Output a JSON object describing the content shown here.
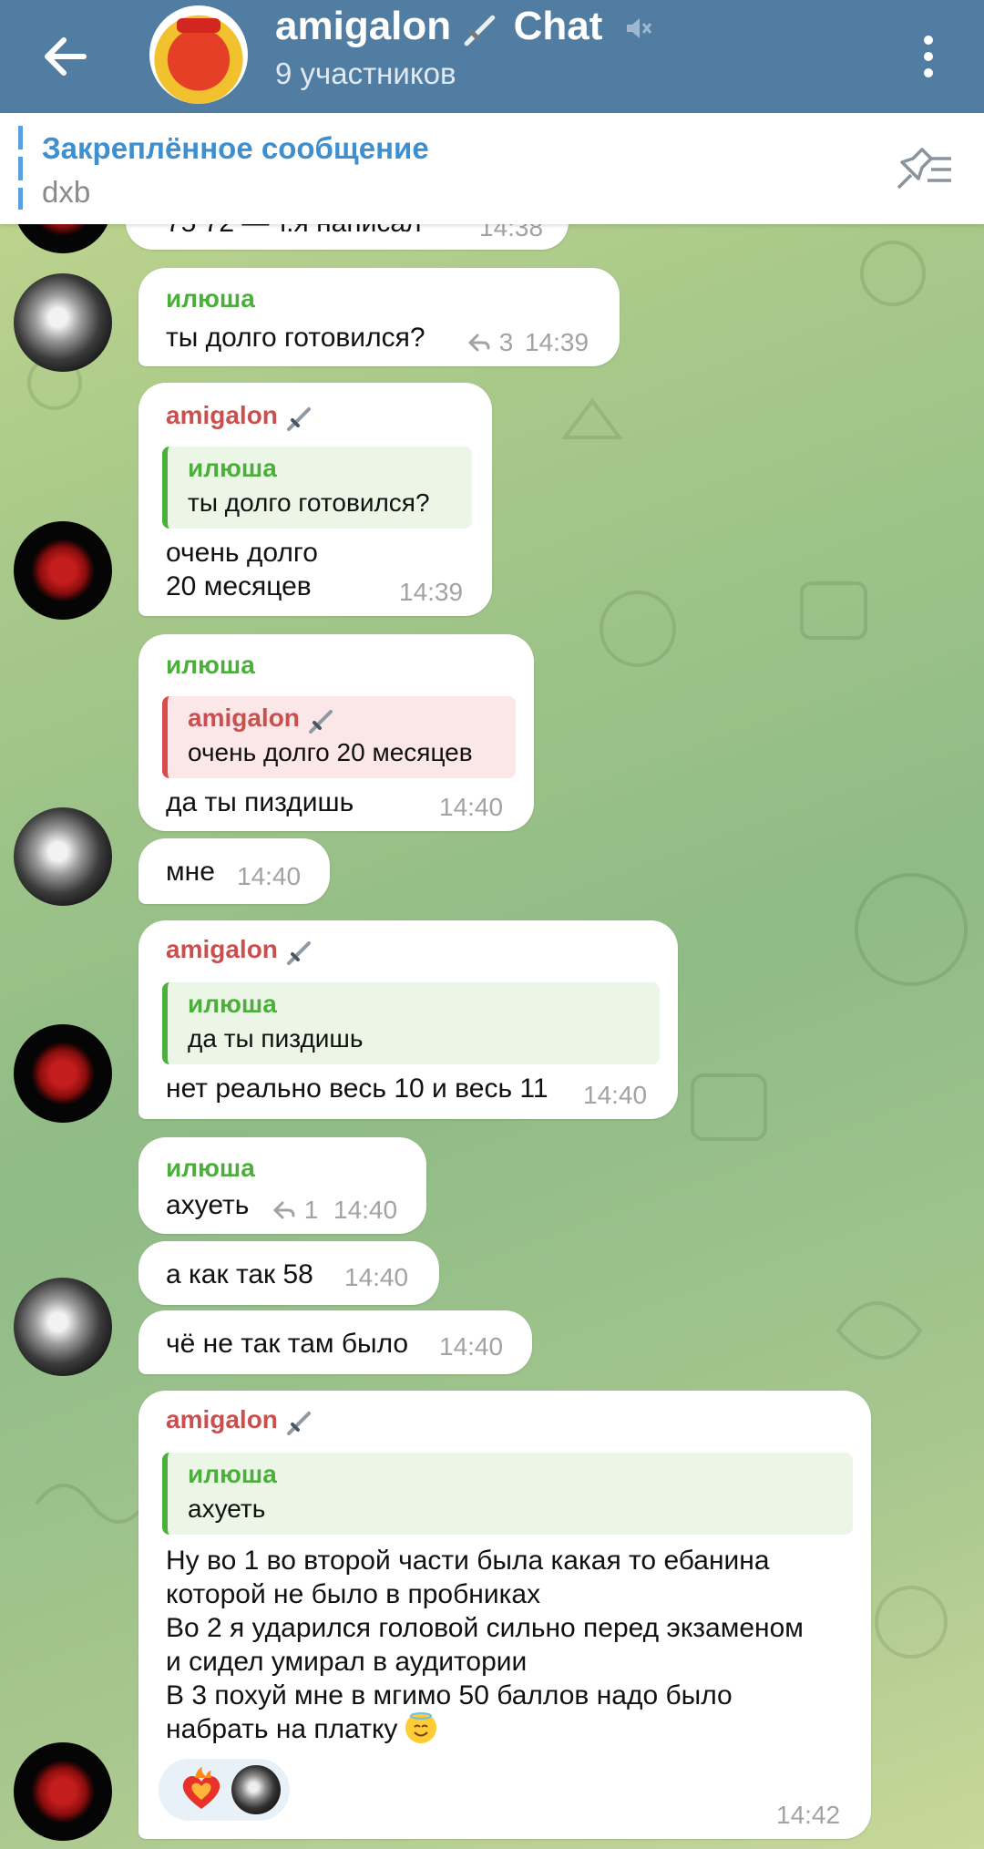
{
  "header": {
    "title": "amigalon",
    "title_suffix": "Chat",
    "subtitle": "9 участников"
  },
  "pinned": {
    "title": "Закреплённое сообщение",
    "text": "dxb"
  },
  "partial_message": {
    "text": "75 72 — т.я написал",
    "time": "14:38"
  },
  "messages": [
    {
      "sender": "илюша",
      "text": "ты долго готовился?",
      "replies": "3",
      "time": "14:39"
    },
    {
      "sender": "amigalon",
      "quote_sender": "илюша",
      "quote_text": "ты долго готовился?",
      "lines": [
        "очень долго",
        "20 месяцев"
      ],
      "time": "14:39"
    },
    {
      "sender": "илюша",
      "quote_sender": "amigalon",
      "quote_text": "очень долго 20 месяцев",
      "text": "да ты пиздишь",
      "time": "14:40"
    },
    {
      "text": "мне",
      "time": "14:40"
    },
    {
      "sender": "amigalon",
      "quote_sender": "илюша",
      "quote_text": "да ты пиздишь",
      "text": "нет реально весь 10 и весь 11",
      "time": "14:40"
    },
    {
      "sender": "илюша",
      "text": "ахуеть",
      "replies": "1",
      "time": "14:40"
    },
    {
      "text": "а как так 58",
      "time": "14:40"
    },
    {
      "text": "чё не так там было",
      "time": "14:40"
    },
    {
      "sender": "amigalon",
      "quote_sender": "илюша",
      "quote_text": "ахуеть",
      "lines": [
        "Ну во 1 во второй части была какая то ебанина",
        "которой не было в пробниках",
        "Во 2 я ударился головой сильно перед экзаменом",
        "и сидел умирал в аудитории",
        "В 3 похуй мне в мгимо 50 баллов надо было",
        "набрать на платку"
      ],
      "time": "14:42"
    }
  ],
  "colors": {
    "header": "#527da3",
    "accent_blue": "#3d8fd0",
    "name_green": "#4caf3c",
    "name_red": "#c9504f"
  },
  "icons": [
    "back-arrow-icon",
    "mute-icon",
    "more-vert-icon",
    "pin-list-icon",
    "dagger-icon",
    "reply-icon",
    "heart-fire-icon",
    "smiling-halo-emoji"
  ]
}
